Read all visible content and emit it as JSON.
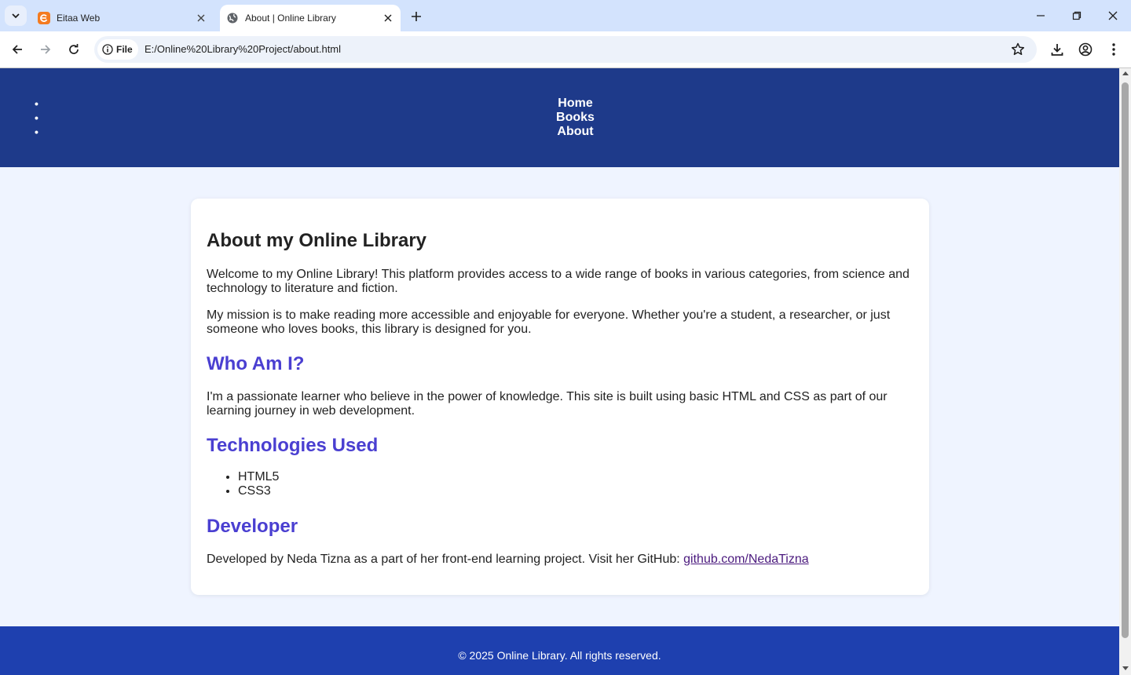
{
  "browser": {
    "tabs": [
      {
        "title": "Eitaa Web",
        "active": false
      },
      {
        "title": "About | Online Library",
        "active": true
      }
    ],
    "site_chip": "File",
    "url": "E:/Online%20Library%20Project/about.html"
  },
  "nav": {
    "items": [
      "Home",
      "Books",
      "About"
    ]
  },
  "about": {
    "title": "About my Online Library",
    "intro": "Welcome to my Online Library! This platform provides access to a wide range of books in various categories, from science and technology to literature and fiction.",
    "mission": "My mission is to make reading more accessible and enjoyable for everyone. Whether you're a student, a researcher, or just someone who loves books, this library is designed for you.",
    "who_heading": "Who Am I?",
    "who_text": "I'm a passionate learner who believe in the power of knowledge. This site is built using basic HTML and CSS as part of our learning journey in web development.",
    "tech_heading": "Technologies Used",
    "technologies": [
      "HTML5",
      "CSS3"
    ],
    "dev_heading": "Developer",
    "dev_text": "Developed by Neda Tizna as a part of her front-end learning project. Visit her GitHub: ",
    "github_link": "github.com/NedaTizna"
  },
  "footer": {
    "text": "© 2025 Online Library. All rights reserved."
  },
  "colors": {
    "header_bg": "#1e3a8a",
    "footer_bg": "#1e40af",
    "heading_accent": "#4a3fd1",
    "page_bg": "#eff4ff"
  }
}
